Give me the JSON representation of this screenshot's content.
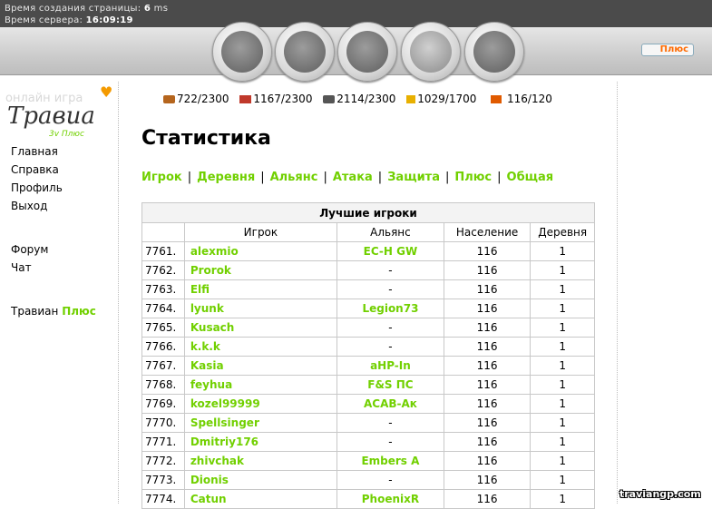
{
  "header": {
    "render_time_label": "Время создания страницы:",
    "render_time_value": "6",
    "render_time_unit": "ms",
    "server_time_label": "Время сервера:",
    "server_time_value": "16:09:19",
    "nav_icons": [
      "village-overview-icon",
      "village-center-icon",
      "map-icon",
      "statistics-icon",
      "reports-icon"
    ],
    "plus_button": "Плюс"
  },
  "sidebar": {
    "logo_text": "Травиан",
    "items": [
      "Главная",
      "Справка",
      "Профиль",
      "Выход"
    ],
    "items2": [
      "Форум",
      "Чат"
    ],
    "travian_label": "Травиан",
    "plus_label": "Плюс"
  },
  "resources": {
    "wood": "722/2300",
    "clay": "1167/2300",
    "iron": "2114/2300",
    "crop": "1029/1700",
    "consumption": "116/120"
  },
  "page_title": "Статистика",
  "tabs": [
    "Игрок",
    "Деревня",
    "Альянс",
    "Атака",
    "Защита",
    "Плюс",
    "Общая"
  ],
  "table": {
    "caption": "Лучшие игроки",
    "headers": [
      "",
      "Игрок",
      "Альянс",
      "Население",
      "Деревня"
    ],
    "rows": [
      {
        "rank": "7761.",
        "player": "alexmio",
        "ally": "EC-H GW",
        "pop": "116",
        "vil": "1"
      },
      {
        "rank": "7762.",
        "player": "Prorok",
        "ally": "-",
        "pop": "116",
        "vil": "1"
      },
      {
        "rank": "7763.",
        "player": "Elfi",
        "ally": "-",
        "pop": "116",
        "vil": "1"
      },
      {
        "rank": "7764.",
        "player": "lyunk",
        "ally": "Legion73",
        "pop": "116",
        "vil": "1"
      },
      {
        "rank": "7765.",
        "player": "Kusach",
        "ally": "-",
        "pop": "116",
        "vil": "1"
      },
      {
        "rank": "7766.",
        "player": "k.k.k",
        "ally": "-",
        "pop": "116",
        "vil": "1"
      },
      {
        "rank": "7767.",
        "player": "Kasia",
        "ally": "aHP-In",
        "pop": "116",
        "vil": "1"
      },
      {
        "rank": "7768.",
        "player": "feyhua",
        "ally": "F&S ПС",
        "pop": "116",
        "vil": "1"
      },
      {
        "rank": "7769.",
        "player": "kozel99999",
        "ally": "ACAB-Ак",
        "pop": "116",
        "vil": "1"
      },
      {
        "rank": "7770.",
        "player": "Spellsinger",
        "ally": "-",
        "pop": "116",
        "vil": "1"
      },
      {
        "rank": "7771.",
        "player": "Dmitriy176",
        "ally": "-",
        "pop": "116",
        "vil": "1"
      },
      {
        "rank": "7772.",
        "player": "zhivchak",
        "ally": "Embers A",
        "pop": "116",
        "vil": "1"
      },
      {
        "rank": "7773.",
        "player": "Dionis",
        "ally": "-",
        "pop": "116",
        "vil": "1"
      },
      {
        "rank": "7774.",
        "player": "Catun",
        "ally": "PhoenixR",
        "pop": "116",
        "vil": "1"
      }
    ]
  },
  "watermark": "traviangp.com",
  "colors": {
    "accent_green": "#71d000",
    "plus_orange": "#ff6a00",
    "topbar_dark": "#4b4b4b"
  }
}
